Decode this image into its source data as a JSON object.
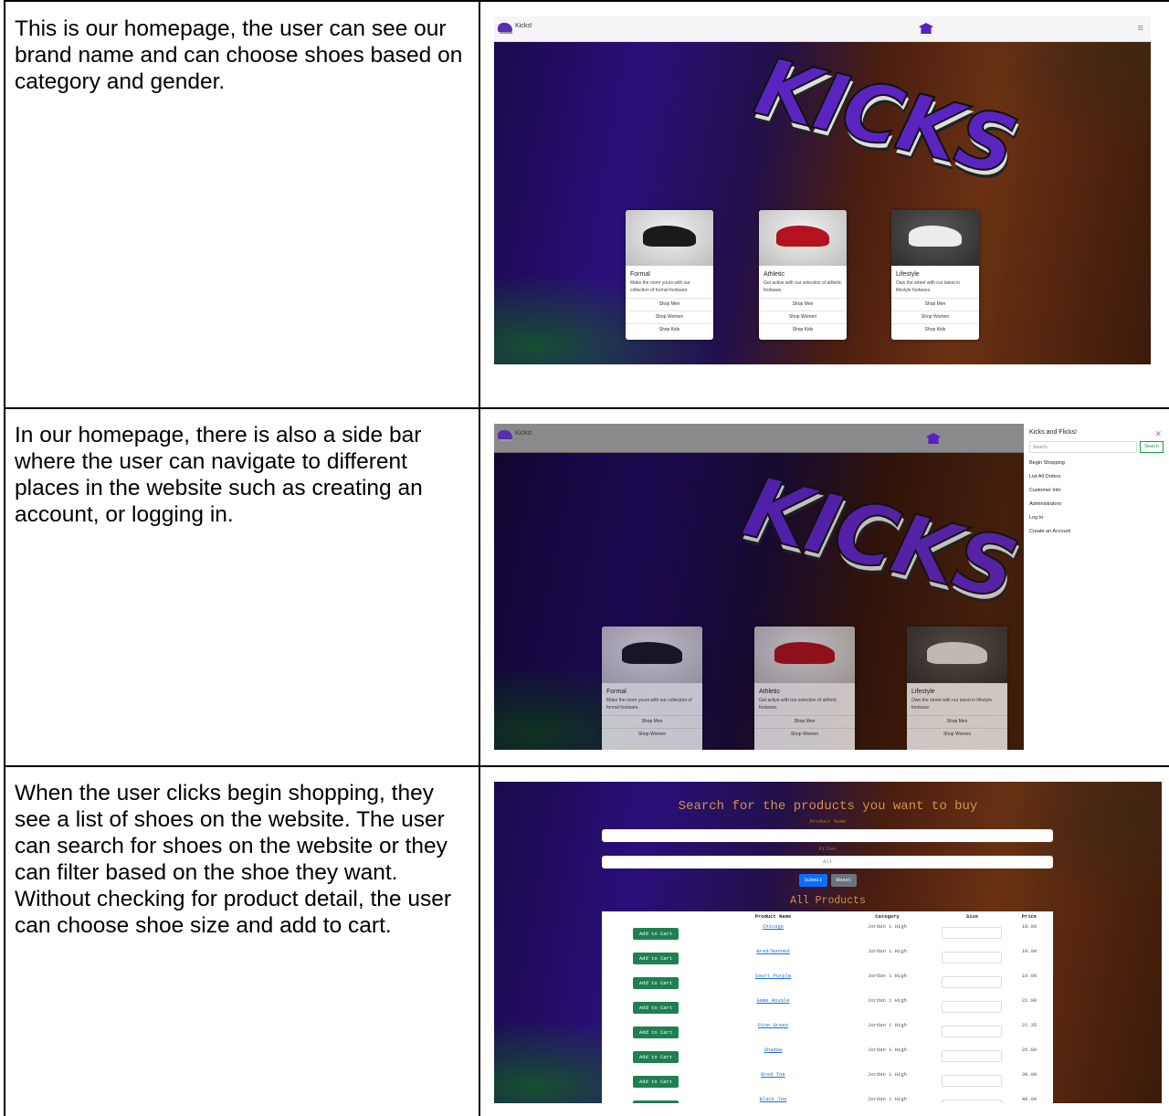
{
  "rows": [
    {
      "description": "This is our homepage, the user can see our brand name and can choose shoes based on category and gender."
    },
    {
      "description": "In our homepage, there is also a side bar where the user can navigate to different places in the website such as creating an account, or logging in."
    },
    {
      "description": "When the user clicks begin shopping, they see a list of shoes on the website. The user can search for shoes on the website or they can filter based on the shoe they want. Without checking for product detail, the user can choose shoe size and add to cart."
    }
  ],
  "site": {
    "brand": "Kicks!",
    "logo_text": "KICKS",
    "menu_icon": "hamburger-icon",
    "cap_icon": "graduation-cap-icon"
  },
  "cards": [
    {
      "title": "Formal",
      "text": "Make the room yours with our collection of formal footware.",
      "links": [
        "Shop Men",
        "Shop Women",
        "Shop Kids"
      ]
    },
    {
      "title": "Athletic",
      "text": "Get active with our selection of athletic footware.",
      "links": [
        "Shop Men",
        "Shop Women",
        "Shop Kids"
      ]
    },
    {
      "title": "Lifestyle",
      "text": "Own the street with our latest in lifestyle footware.",
      "links": [
        "Shop Men",
        "Shop Women",
        "Shop Kids"
      ]
    }
  ],
  "sidebar": {
    "title": "Kicks and Flicks!",
    "search_placeholder": "Search",
    "search_button": "Search",
    "items": [
      "Begin Shopping",
      "List All Orders",
      "Customer Info",
      "Administrators",
      "Log In",
      "Create an Account"
    ]
  },
  "shop": {
    "heading": "Search for the products you want to buy",
    "product_name_label": "Product Name",
    "filter_label": "Filter",
    "filter_value": "All",
    "submit": "Submit",
    "reset": "Reset",
    "all_products": "All Products",
    "columns": [
      "Product Name",
      "Category",
      "Size",
      "Price"
    ],
    "add_label": "Add to Cart",
    "products": [
      {
        "name": "Chicago",
        "category": "Jordan 1 High",
        "price": "18.00"
      },
      {
        "name": "Bred/Banned",
        "category": "Jordan 1 High",
        "price": "19.00"
      },
      {
        "name": "Court Purple",
        "category": "Jordan 1 High",
        "price": "10.00"
      },
      {
        "name": "Game Royale",
        "category": "Jordan 1 High",
        "price": "22.00"
      },
      {
        "name": "Pine Green",
        "category": "Jordan 1 High",
        "price": "21.35"
      },
      {
        "name": "Shadow",
        "category": "Jordan 1 High",
        "price": "25.00"
      },
      {
        "name": "Bred Toe",
        "category": "Jordan 1 High",
        "price": "30.00"
      },
      {
        "name": "Black Toe",
        "category": "Jordan 1 High",
        "price": "40.00"
      }
    ]
  }
}
